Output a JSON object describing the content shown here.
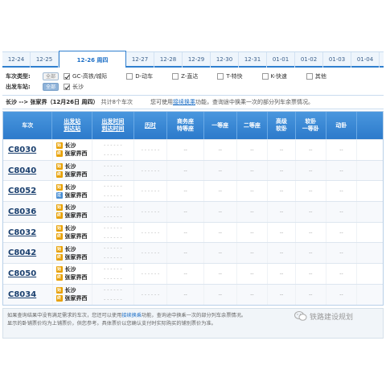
{
  "date_tabs": [
    {
      "label": "12-24",
      "active": false
    },
    {
      "label": "12-25",
      "active": false
    },
    {
      "label": "12-26",
      "weekday": "周四",
      "active": true
    },
    {
      "label": "12-27",
      "active": false
    },
    {
      "label": "12-28",
      "active": false
    },
    {
      "label": "12-29",
      "active": false
    },
    {
      "label": "12-30",
      "active": false
    },
    {
      "label": "12-31",
      "active": false
    },
    {
      "label": "01-01",
      "active": false
    },
    {
      "label": "01-02",
      "active": false
    },
    {
      "label": "01-03",
      "active": false
    },
    {
      "label": "01-04",
      "active": false
    }
  ],
  "filters": {
    "train_type_label": "车次类型:",
    "all_label": "全部",
    "types": [
      {
        "label": "GC-高铁/城际",
        "checked": true
      },
      {
        "label": "D-动车",
        "checked": false
      },
      {
        "label": "Z-直达",
        "checked": false
      },
      {
        "label": "T-特快",
        "checked": false
      },
      {
        "label": "K-快速",
        "checked": false
      },
      {
        "label": "其他",
        "checked": false
      }
    ],
    "station_label": "出发车站:",
    "station_all_label": "全部",
    "stations": [
      {
        "label": "长沙",
        "checked": true
      }
    ]
  },
  "summary": {
    "route": "长沙 --> 张家界（12月26日 周四）",
    "count": "共计8个车次",
    "tip_pre": "您可使用",
    "tip_link": "接续换乘",
    "tip_post": "功能，查询途中换乘一次的部分列车余票情况。"
  },
  "table": {
    "headers": {
      "train": "车次",
      "station": [
        "出发站",
        "到达站"
      ],
      "time": [
        "出发时间",
        "到达时间"
      ],
      "duration": "历时",
      "business": [
        "商务座",
        "特等座"
      ],
      "first": "一等座",
      "second": "二等座",
      "soft_sleeper_hi": [
        "高级",
        "软卧"
      ],
      "soft_sleeper": [
        "软卧",
        "一等卧"
      ],
      "motor_sleeper": "动卧"
    },
    "rows": [
      {
        "train": "C8030",
        "from": "长沙",
        "to": "张家界西",
        "from_badge": "始",
        "to_badge": "终"
      },
      {
        "train": "C8040",
        "from": "长沙",
        "to": "张家界西",
        "from_badge": "始",
        "to_badge": "终"
      },
      {
        "train": "C8052",
        "from": "长沙",
        "to": "张家界西",
        "from_badge": "始",
        "to_badge": "过"
      },
      {
        "train": "C8036",
        "from": "长沙",
        "to": "张家界西",
        "from_badge": "始",
        "to_badge": "终"
      },
      {
        "train": "C8032",
        "from": "长沙",
        "to": "张家界西",
        "from_badge": "始",
        "to_badge": "终"
      },
      {
        "train": "C8042",
        "from": "长沙",
        "to": "张家界西",
        "from_badge": "始",
        "to_badge": "终"
      },
      {
        "train": "C8050",
        "from": "长沙",
        "to": "张家界西",
        "from_badge": "始",
        "to_badge": "终"
      },
      {
        "train": "C8034",
        "from": "长沙",
        "to": "张家界西",
        "from_badge": "始",
        "to_badge": "终"
      }
    ],
    "time_placeholder": "- - - - - -",
    "seat_placeholder": "--"
  },
  "notes": {
    "line1_pre": "如果查询结果中没有满足需求的车次，您还可以使用",
    "line1_link": "接续换乘",
    "line1_post": "功能，查询途中换乘一次的部分列车余票情况。",
    "line2": "显示的卧铺票价均为上铺票价，供您参考。具体票价以您确认支付时实际购买的铺别票价为准。"
  },
  "watermark": "铁路建设规划",
  "colors": {
    "accent": "#2f7fcf",
    "header": "#3a8ad6",
    "link": "#1d6fc6",
    "badge_start": "#e8a000",
    "badge_pass": "#4a8fd4"
  }
}
